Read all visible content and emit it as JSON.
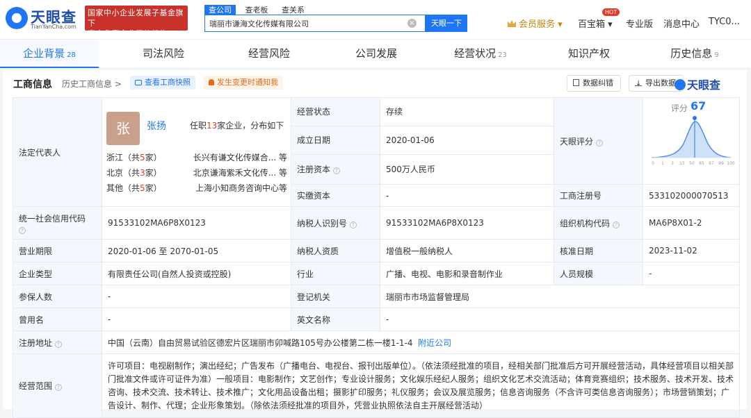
{
  "header": {
    "logo_cn": "天眼查",
    "logo_en": "TianYanCha.com",
    "badge_line1": "国家中小企业发展子基金旗下",
    "badge_line2": "官方备案企业征信机构",
    "search_tabs": [
      "查公司",
      "查老板",
      "查关系"
    ],
    "search_value": "瑞丽市谦海文化传媒有限公司",
    "search_button": "天眼一下",
    "nav": {
      "member": "会员服务 ▾",
      "hot": "HOT",
      "baibao": "百宝箱 ▾",
      "pro": "专业版",
      "messages": "消息中心",
      "user": "TYC0..."
    }
  },
  "tabs": [
    {
      "label": "企业背景",
      "count": "28"
    },
    {
      "label": "司法风险",
      "count": ""
    },
    {
      "label": "经营风险",
      "count": ""
    },
    {
      "label": "公司发展",
      "count": ""
    },
    {
      "label": "经营状况",
      "count": "23"
    },
    {
      "label": "知识产权",
      "count": ""
    },
    {
      "label": "历史信息",
      "count": "9"
    }
  ],
  "section": {
    "title": "工商信息",
    "history": "历史工商信息 >",
    "snapshot": "查看工商快照",
    "notify": "发生变更时通知我",
    "report": "数据纠错",
    "export": "导出数据",
    "logo": "天眼查"
  },
  "legal_rep": {
    "label": "法定代表人",
    "avatar_char": "张",
    "name": "张扬",
    "pos_prefix": "任职",
    "pos_count": "13",
    "pos_suffix": "家企业，分布如下",
    "provinces": [
      {
        "prov": "浙江（共",
        "num": "5",
        "unit": "家）",
        "company": "长兴有谦文化传媒合...  等"
      },
      {
        "prov": "北京（共",
        "num": "3",
        "unit": "家）",
        "company": "北京谦海紫禾文化传...  等"
      },
      {
        "prov": "其他（共",
        "num": "5",
        "unit": "家）",
        "company": "上海小知商务咨询中心等"
      }
    ]
  },
  "fields": {
    "status_label": "经营状态",
    "status": "存续",
    "est_label": "成立日期",
    "est": "2020-01-06",
    "reg_cap_label": "注册资本",
    "reg_cap": "500万人民币",
    "paid_cap_label": "实缴资本",
    "paid_cap": "-",
    "score_label": "天眼评分",
    "score_title": "评分",
    "score_value": "67",
    "score_axis": [
      "0",
      "1",
      "3",
      "15",
      "50",
      "85",
      "97",
      "99",
      "100"
    ],
    "reg_no_label": "工商注册号",
    "reg_no": "533102000070513",
    "credit_label": "统一社会信用代码",
    "credit": "91533102MA6P8X0123",
    "tax_label": "纳税人识别号",
    "tax": "91533102MA6P8X0123",
    "org_label": "组织机构代码",
    "org": "MA6P8X01-2",
    "term_label": "营业期限",
    "term": "2020-01-06 至 2070-01-05",
    "taxpayer_label": "纳税人资质",
    "taxpayer": "增值税一般纳税人",
    "approve_label": "核准日期",
    "approve": "2023-11-02",
    "type_label": "企业类型",
    "type": "有限责任公司(自然人投资或控股)",
    "industry_label": "行业",
    "industry": "广播、电视、电影和录音制作业",
    "staff_label": "人员规模",
    "staff": "-",
    "insured_label": "参保人数",
    "insured": "-",
    "authority_label": "登记机关",
    "authority": "瑞丽市市场监督管理局",
    "former_label": "曾用名",
    "former": "-",
    "en_label": "英文名称",
    "en": "-",
    "address_label": "注册地址",
    "address": "中国（云南）自由贸易试验区德宏片区瑞丽市卯喊路105号办公楼第二栋一楼1-1-4",
    "nearby": "附近公司",
    "scope_label": "经营范围",
    "scope": "许可项目：电视剧制作；演出经纪；广告发布（广播电台、电视台、报刊出版单位）。（依法须经批准的项目，经相关部门批准后方可开展经营活动，具体经营项目以相关部门批准文件或许可证件为准）一般项目：电影制作；文艺创作；专业设计服务；文化娱乐经纪人服务；组织文化艺术交流活动；体育竞赛组织；技术服务、技术开发、技术咨询、技术交流、技术转让、技术推广；文化用品设备出租；摄影扩印服务；礼仪服务；会议及展览服务；信息咨询服务（不含许可类信息咨询服务）；市场营销策划；广告设计、制作、代理；企业形象策划。（除依法须经批准的项目外，凭营业执照依法自主开展经营活动）"
  },
  "colors": {
    "accent": "#1f76f5",
    "brand": "#1f4fae",
    "badge": "#c8322b"
  }
}
